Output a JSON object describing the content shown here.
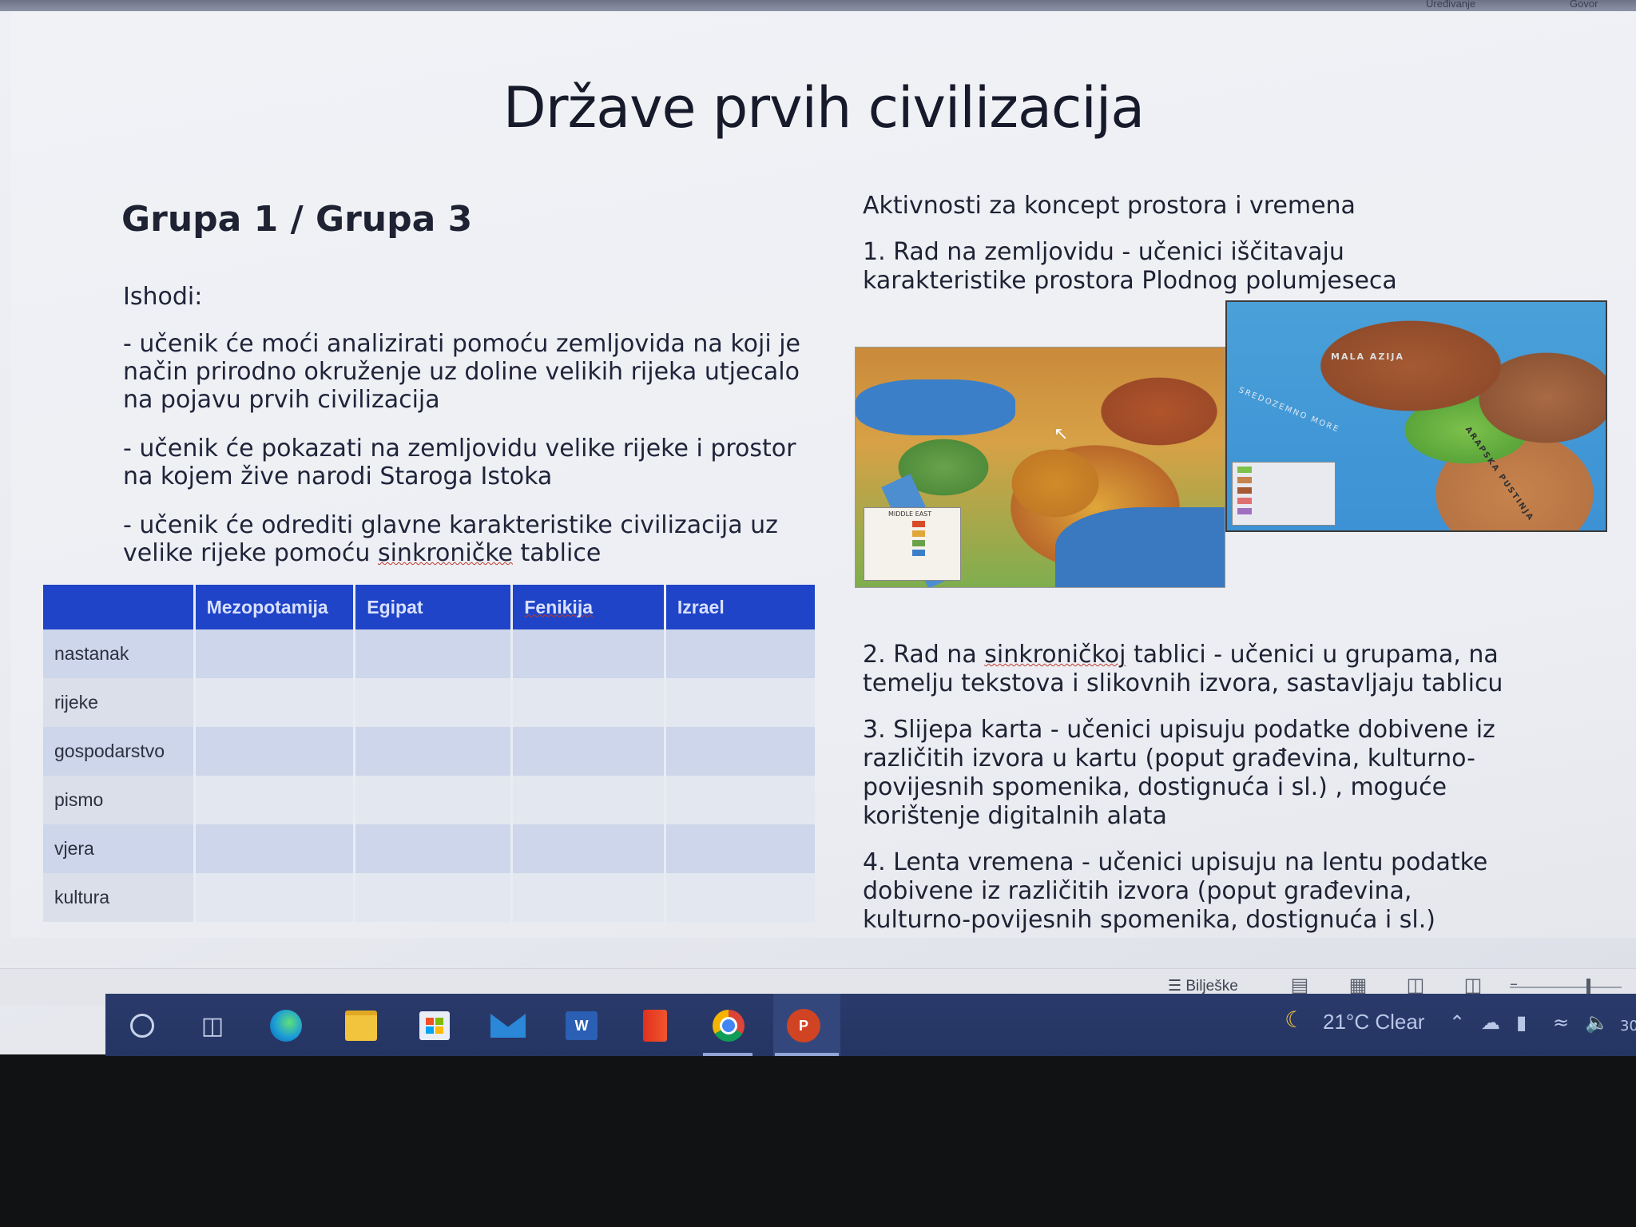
{
  "app": {
    "ribbon_tabs": [
      "Uređivanje",
      "Govor"
    ]
  },
  "slide": {
    "title": "Države prvih civilizacija",
    "group_title": "Grupa 1 / Grupa 3",
    "outcomes_label": "Ishodi:",
    "outcomes": [
      "- učenik će moći analizirati pomoću zemljovida na koji je način prirodno okruženje uz doline velikih rijeka utjecalo na pojavu prvih civilizacija",
      "- učenik će pokazati na zemljovidu velike rijeke i prostor na kojem žive narodi Staroga Istoka"
    ],
    "outcome3_before": "- učenik će odrediti glavne karakteristike civilizacija uz velike rijeke pomoću ",
    "outcome3_word": "sinkroničke",
    "outcome3_after": " tablice",
    "table": {
      "headers": [
        "",
        "Mezopotamija",
        "Egipat",
        "Fenikija",
        "Izrael"
      ],
      "rows": [
        "nastanak",
        "rijeke",
        "gospodarstvo",
        "pismo",
        "vjera",
        "kultura"
      ]
    },
    "right_heading": "Aktivnosti za koncept prostora i vremena",
    "activity1": "1. Rad na zemljovidu - učenici iščitavaju karakteristike prostora Plodnog polumjeseca",
    "activity2_before": "2. Rad na ",
    "activity2_word": "sinkroničkoj",
    "activity2_after": " tablici - učenici u grupama, na temelju tekstova i slikovnih izvora, sastavljaju tablicu",
    "activity3": "3. Slijepa karta - učenici upisuju podatke dobivene iz različitih izvora u kartu (poput građevina, kulturno-povijesnih spomenika, dostignuća i sl.) , moguće korištenje digitalnih alata",
    "activity4": "4. Lenta vremena - učenici upisuju na lentu podatke dobivene iz različitih izvora (poput građevina, kulturno-povijesnih spomenika, dostignuća i sl.)",
    "map1_label": "MIDDLE EAST",
    "map2_labels": [
      "MALA AZIJA",
      "SREDOZEMNO MORE",
      "ARAPSKA PUSTINJA"
    ]
  },
  "statusbar": {
    "notes_label": "Bilješke"
  },
  "taskbar": {
    "weather": "21°C  Clear",
    "clock_partial": "30",
    "icons": [
      "search-circle-icon",
      "task-view-icon",
      "edge-icon",
      "file-explorer-icon",
      "store-icon",
      "mail-icon",
      "word-icon",
      "office-icon",
      "chrome-icon",
      "powerpoint-icon"
    ]
  }
}
